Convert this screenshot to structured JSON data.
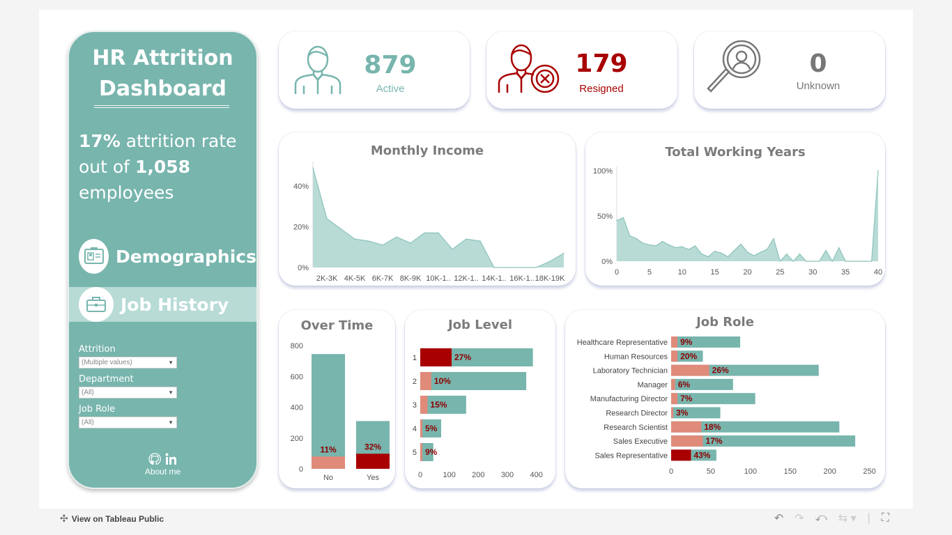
{
  "sidebar": {
    "title_line1": "HR Attrition",
    "title_line2": "Dashboard",
    "rate_value": "17%",
    "rate_text": "attrition rate",
    "out_of_text": "out of",
    "employees_value": "1,058",
    "employees_text": "employees",
    "nav": [
      {
        "label": "Demographics",
        "icon": "id-card-icon"
      },
      {
        "label": "Job History",
        "icon": "briefcase-icon",
        "selected": true
      }
    ],
    "filters": [
      {
        "label": "Attrition",
        "value": "(Multiple values)"
      },
      {
        "label": "Department",
        "value": "(All)"
      },
      {
        "label": "Job Role",
        "value": "(All)"
      }
    ],
    "about_label": "About me"
  },
  "kpis": [
    {
      "value": "879",
      "label": "Active",
      "color": "#77b5ad",
      "icon": "employee-icon"
    },
    {
      "value": "179",
      "label": "Resigned",
      "color": "#a80000",
      "icon": "employee-resigned-icon"
    },
    {
      "value": "0",
      "label": "Unknown",
      "color": "#777777",
      "icon": "magnifier-person-icon"
    }
  ],
  "colors": {
    "teal": "#77b5ad",
    "teal_area": "#b8dbd6",
    "salmon": "#e08a7a",
    "dark_red": "#a80000"
  },
  "chart_data": [
    {
      "type": "area",
      "title": "Monthly Income",
      "ytick_labels": [
        "0%",
        "20%",
        "40%"
      ],
      "xtick_labels": [
        "2K-3K",
        "4K-5K",
        "6K-7K",
        "8K-9K",
        "10K-1..",
        "12K-1..",
        "14K-1..",
        "16K-1..",
        "18K-19K"
      ],
      "x_index": [
        0,
        1,
        2,
        3,
        4,
        5,
        6,
        7,
        8,
        9,
        10,
        11,
        12,
        13,
        14,
        15,
        16,
        17,
        18
      ],
      "values": [
        0.49,
        0.24,
        0.19,
        0.14,
        0.13,
        0.11,
        0.15,
        0.12,
        0.17,
        0.17,
        0.09,
        0.14,
        0.13,
        0.0,
        0.0,
        0.0,
        0.0,
        0.03,
        0.07
      ],
      "ylim": [
        0,
        0.5
      ]
    },
    {
      "type": "area",
      "title": "Total Working Years",
      "ytick_labels": [
        "0%",
        "50%",
        "100%"
      ],
      "xtick_labels": [
        "0",
        "5",
        "10",
        "15",
        "20",
        "25",
        "30",
        "35",
        "40"
      ],
      "x": [
        0,
        1,
        2,
        3,
        4,
        5,
        6,
        7,
        8,
        9,
        10,
        11,
        12,
        13,
        14,
        15,
        16,
        17,
        18,
        19,
        20,
        21,
        22,
        23,
        24,
        25,
        26,
        27,
        28,
        29,
        30,
        31,
        32,
        33,
        34,
        35,
        36,
        37,
        38,
        39,
        40
      ],
      "values": [
        0.45,
        0.48,
        0.28,
        0.25,
        0.2,
        0.18,
        0.17,
        0.22,
        0.18,
        0.15,
        0.16,
        0.13,
        0.17,
        0.08,
        0.05,
        0.11,
        0.09,
        0.05,
        0.12,
        0.19,
        0.1,
        0.06,
        0.1,
        0.13,
        0.25,
        0.0,
        0.08,
        0.0,
        0.08,
        0.0,
        0.0,
        0.0,
        0.12,
        0.0,
        0.15,
        0.0,
        0.0,
        0.0,
        0.0,
        0.0,
        1.0
      ],
      "xlim": [
        0,
        40
      ],
      "ylim": [
        0,
        1.0
      ]
    },
    {
      "type": "bar",
      "title": "Over Time",
      "categories": [
        "No",
        "Yes"
      ],
      "ytick_labels": [
        "0",
        "200",
        "400",
        "600",
        "800"
      ],
      "series": [
        {
          "values": [
            745,
            310
          ]
        },
        {
          "values": [
            80,
            98
          ]
        }
      ],
      "data_labels": [
        "11%",
        "32%"
      ],
      "ylim": [
        0,
        850
      ]
    },
    {
      "type": "bar",
      "title": "Job Level",
      "orientation": "horizontal",
      "categories": [
        "1",
        "2",
        "3",
        "4",
        "5"
      ],
      "xtick_labels": [
        "0",
        "100",
        "200",
        "300",
        "400"
      ],
      "series": [
        {
          "values": [
            388,
            365,
            158,
            72,
            45
          ]
        },
        {
          "values": [
            108,
            38,
            25,
            4,
            4
          ]
        }
      ],
      "data_labels": [
        "27%",
        "10%",
        "15%",
        "5%",
        "9%"
      ],
      "xlim": [
        0,
        420
      ]
    },
    {
      "type": "bar",
      "title": "Job Role",
      "orientation": "horizontal",
      "categories": [
        "Healthcare Representative",
        "Human Resources",
        "Laboratory Technician",
        "Manager",
        "Manufacturing Director",
        "Research Director",
        "Research Scientist",
        "Sales Executive",
        "Sales Representative"
      ],
      "xtick_labels": [
        "0",
        "50",
        "100",
        "150",
        "200",
        "250"
      ],
      "series": [
        {
          "values": [
            87,
            40,
            186,
            78,
            106,
            62,
            212,
            232,
            57
          ]
        },
        {
          "values": [
            8,
            8,
            48,
            5,
            8,
            2,
            38,
            40,
            25
          ]
        }
      ],
      "data_labels": [
        "9%",
        "20%",
        "26%",
        "6%",
        "7%",
        "3%",
        "18%",
        "17%",
        "43%"
      ],
      "xlim": [
        0,
        260
      ]
    }
  ],
  "footer": {
    "view_on": "View on Tableau Public"
  }
}
